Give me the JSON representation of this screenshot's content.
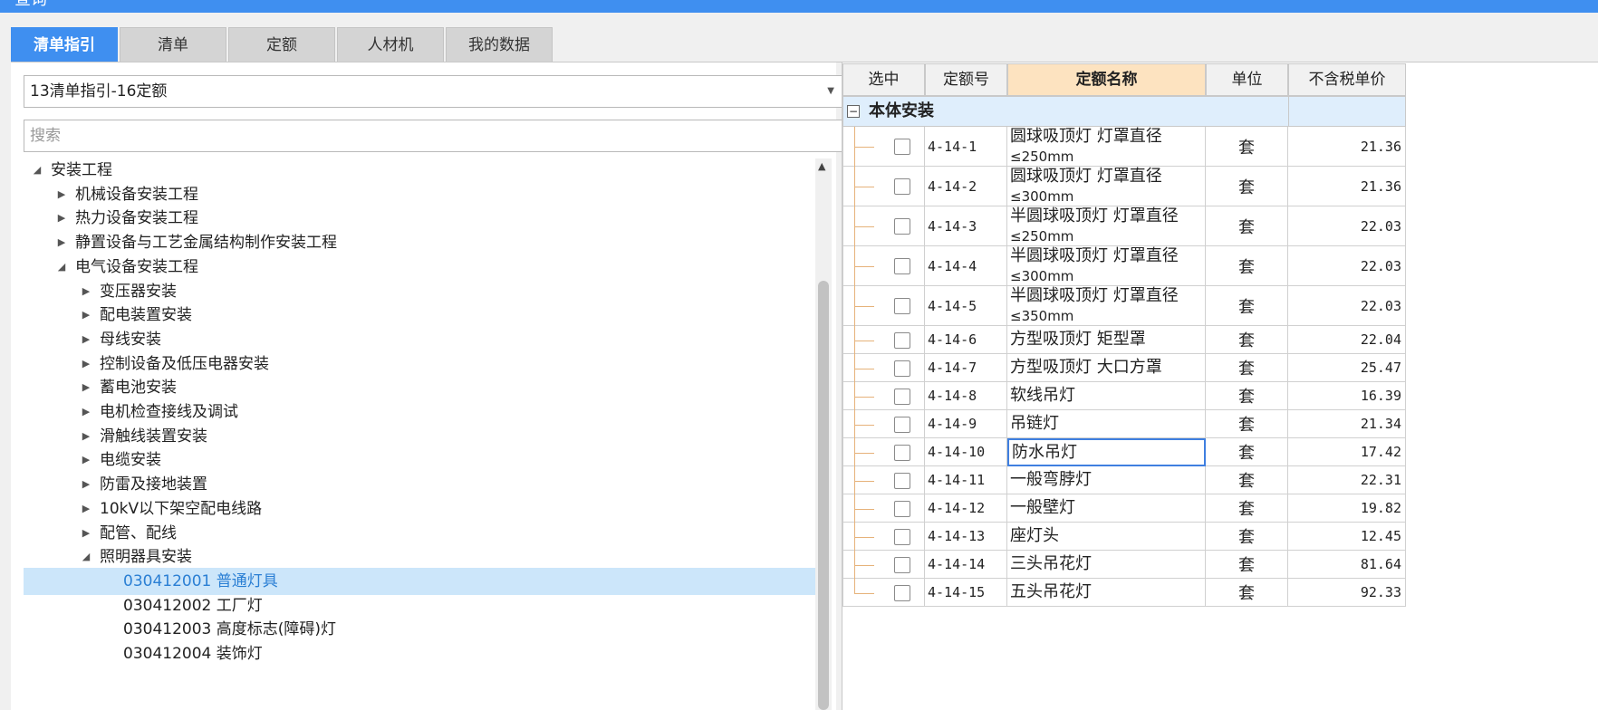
{
  "window": {
    "title": "查询"
  },
  "tabs": [
    {
      "label": "清单指引",
      "active": true
    },
    {
      "label": "清单",
      "active": false
    },
    {
      "label": "定额",
      "active": false
    },
    {
      "label": "人材机",
      "active": false
    },
    {
      "label": "我的数据",
      "active": false
    }
  ],
  "left": {
    "library_select": "13清单指引-16定额",
    "search_placeholder": "搜索",
    "tree": [
      {
        "label": "安装工程",
        "level": 0,
        "state": "expanded"
      },
      {
        "label": "机械设备安装工程",
        "level": 1,
        "state": "collapsed"
      },
      {
        "label": "热力设备安装工程",
        "level": 1,
        "state": "collapsed"
      },
      {
        "label": "静置设备与工艺金属结构制作安装工程",
        "level": 1,
        "state": "collapsed"
      },
      {
        "label": "电气设备安装工程",
        "level": 1,
        "state": "expanded"
      },
      {
        "label": "变压器安装",
        "level": 2,
        "state": "collapsed"
      },
      {
        "label": "配电装置安装",
        "level": 2,
        "state": "collapsed"
      },
      {
        "label": "母线安装",
        "level": 2,
        "state": "collapsed"
      },
      {
        "label": "控制设备及低压电器安装",
        "level": 2,
        "state": "collapsed"
      },
      {
        "label": "蓄电池安装",
        "level": 2,
        "state": "collapsed"
      },
      {
        "label": "电机检查接线及调试",
        "level": 2,
        "state": "collapsed"
      },
      {
        "label": "滑触线装置安装",
        "level": 2,
        "state": "collapsed"
      },
      {
        "label": "电缆安装",
        "level": 2,
        "state": "collapsed"
      },
      {
        "label": "防雷及接地装置",
        "level": 2,
        "state": "collapsed"
      },
      {
        "label": "10kV以下架空配电线路",
        "level": 2,
        "state": "collapsed"
      },
      {
        "label": "配管、配线",
        "level": 2,
        "state": "collapsed"
      },
      {
        "label": "照明器具安装",
        "level": 2,
        "state": "expanded"
      },
      {
        "label": "030412001  普通灯具",
        "level": 3,
        "state": "leaf",
        "selected": true
      },
      {
        "label": "030412002  工厂灯",
        "level": 3,
        "state": "leaf"
      },
      {
        "label": "030412003  高度标志(障碍)灯",
        "level": 3,
        "state": "leaf"
      },
      {
        "label": "030412004  装饰灯",
        "level": 3,
        "state": "leaf"
      }
    ]
  },
  "grid": {
    "headers": [
      "选中",
      "定额号",
      "定额名称",
      "单位",
      "不含税单价"
    ],
    "group": {
      "toggle": "−",
      "label": "本体安装"
    },
    "rows": [
      {
        "code": "4-14-1",
        "name": "圆球吸顶灯 灯罩直径",
        "name2": "≤250mm",
        "unit": "套",
        "price": "21.36"
      },
      {
        "code": "4-14-2",
        "name": "圆球吸顶灯 灯罩直径",
        "name2": "≤300mm",
        "unit": "套",
        "price": "21.36"
      },
      {
        "code": "4-14-3",
        "name": "半圆球吸顶灯 灯罩直径",
        "name2": "≤250mm",
        "unit": "套",
        "price": "22.03"
      },
      {
        "code": "4-14-4",
        "name": "半圆球吸顶灯 灯罩直径",
        "name2": "≤300mm",
        "unit": "套",
        "price": "22.03"
      },
      {
        "code": "4-14-5",
        "name": "半圆球吸顶灯 灯罩直径",
        "name2": "≤350mm",
        "unit": "套",
        "price": "22.03"
      },
      {
        "code": "4-14-6",
        "name": "方型吸顶灯 矩型罩",
        "name2": "",
        "unit": "套",
        "price": "22.04"
      },
      {
        "code": "4-14-7",
        "name": "方型吸顶灯 大口方罩",
        "name2": "",
        "unit": "套",
        "price": "25.47"
      },
      {
        "code": "4-14-8",
        "name": "软线吊灯",
        "name2": "",
        "unit": "套",
        "price": "16.39"
      },
      {
        "code": "4-14-9",
        "name": "吊链灯",
        "name2": "",
        "unit": "套",
        "price": "21.34"
      },
      {
        "code": "4-14-10",
        "name": "防水吊灯",
        "name2": "",
        "unit": "套",
        "price": "17.42",
        "focused": true
      },
      {
        "code": "4-14-11",
        "name": "一般弯脖灯",
        "name2": "",
        "unit": "套",
        "price": "22.31"
      },
      {
        "code": "4-14-12",
        "name": "一般壁灯",
        "name2": "",
        "unit": "套",
        "price": "19.82"
      },
      {
        "code": "4-14-13",
        "name": "座灯头",
        "name2": "",
        "unit": "套",
        "price": "12.45"
      },
      {
        "code": "4-14-14",
        "name": "三头吊花灯",
        "name2": "",
        "unit": "套",
        "price": "81.64"
      },
      {
        "code": "4-14-15",
        "name": "五头吊花灯",
        "name2": "",
        "unit": "套",
        "price": "92.33"
      }
    ]
  }
}
